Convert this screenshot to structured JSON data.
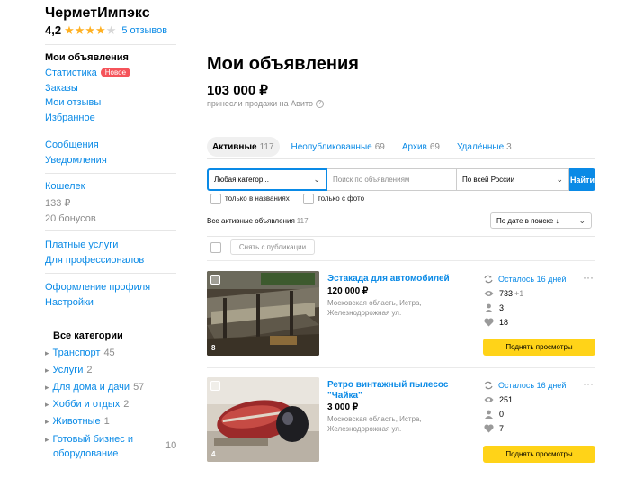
{
  "sidebar": {
    "company": "ЧерметИмпэкс",
    "rating": "4,2",
    "stars_filled": 4,
    "reviews": "5 отзывов",
    "menu": {
      "my_ads": "Мои объявления",
      "stats": "Статистика",
      "stats_badge": "Новое",
      "orders": "Заказы",
      "my_reviews": "Мои отзывы",
      "favorites": "Избранное",
      "messages": "Сообщения",
      "notifications": "Уведомления",
      "wallet": "Кошелек",
      "wallet_balance": "133 ₽",
      "bonuses": "20 бонусов",
      "paid_services": "Платные услуги",
      "for_pros": "Для профессионалов",
      "profile_design": "Оформление профиля",
      "settings": "Настройки"
    },
    "categories_title": "Все категории",
    "categories": [
      {
        "label": "Транспорт",
        "count": "45"
      },
      {
        "label": "Услуги",
        "count": "2"
      },
      {
        "label": "Для дома и дачи",
        "count": "57"
      },
      {
        "label": "Хобби и отдых",
        "count": "2"
      },
      {
        "label": "Животные",
        "count": "1"
      },
      {
        "label": "Готовый бизнес и",
        "label2": "оборудование",
        "count": "10"
      }
    ]
  },
  "main": {
    "title": "Мои объявления",
    "sales_amount": "103 000 ₽",
    "sales_caption": "принесли продажи на Авито",
    "tabs": [
      {
        "label": "Активные",
        "count": "117"
      },
      {
        "label": "Неопубликованные",
        "count": "69"
      },
      {
        "label": "Архив",
        "count": "69"
      },
      {
        "label": "Удалённые",
        "count": "3"
      }
    ],
    "search": {
      "category_value": "Любая категор...",
      "query_placeholder": "Поиск по объявлениям",
      "region_value": "По всей России",
      "button": "Найти"
    },
    "filters": {
      "titles_only": "только в названиях",
      "with_photo": "только с фото"
    },
    "all_ads_label": "Все активные объявления",
    "all_ads_count": "117",
    "sort_value": "По дате в поиске ↓",
    "unpublish_button": "Снять с публикации",
    "ads": [
      {
        "title": "Эстакада для автомобилей",
        "price": "120 000 ₽",
        "location_1": "Московская область, Истра,",
        "location_2": "Железнодорожная ул.",
        "photos": "8",
        "days_left": "Осталось 16 дней",
        "views": "733",
        "views_plus": "+1",
        "contacts": "3",
        "favorites": "18",
        "promo_button": "Поднять просмотры"
      },
      {
        "title": "Ретро винтажный пылесос",
        "title_2": "\"Чайка\"",
        "price": "3 000 ₽",
        "location_1": "Московская область, Истра,",
        "location_2": "Железнодорожная ул.",
        "photos": "4",
        "days_left": "Осталось 16 дней",
        "views": "251",
        "views_plus": "",
        "contacts": "0",
        "favorites": "7",
        "promo_button": "Поднять просмотры"
      }
    ]
  },
  "colors": {
    "link": "#0a8ae6",
    "accent_button": "#0a8ae6",
    "promo_button": "#ffd318",
    "star": "#ffb021",
    "badge_new": "#f5535a"
  },
  "icons": [
    "refresh-icon",
    "eye-icon",
    "person-icon",
    "heart-icon",
    "chevron-down-icon",
    "question-icon",
    "more-icon",
    "triangle-right-icon"
  ]
}
